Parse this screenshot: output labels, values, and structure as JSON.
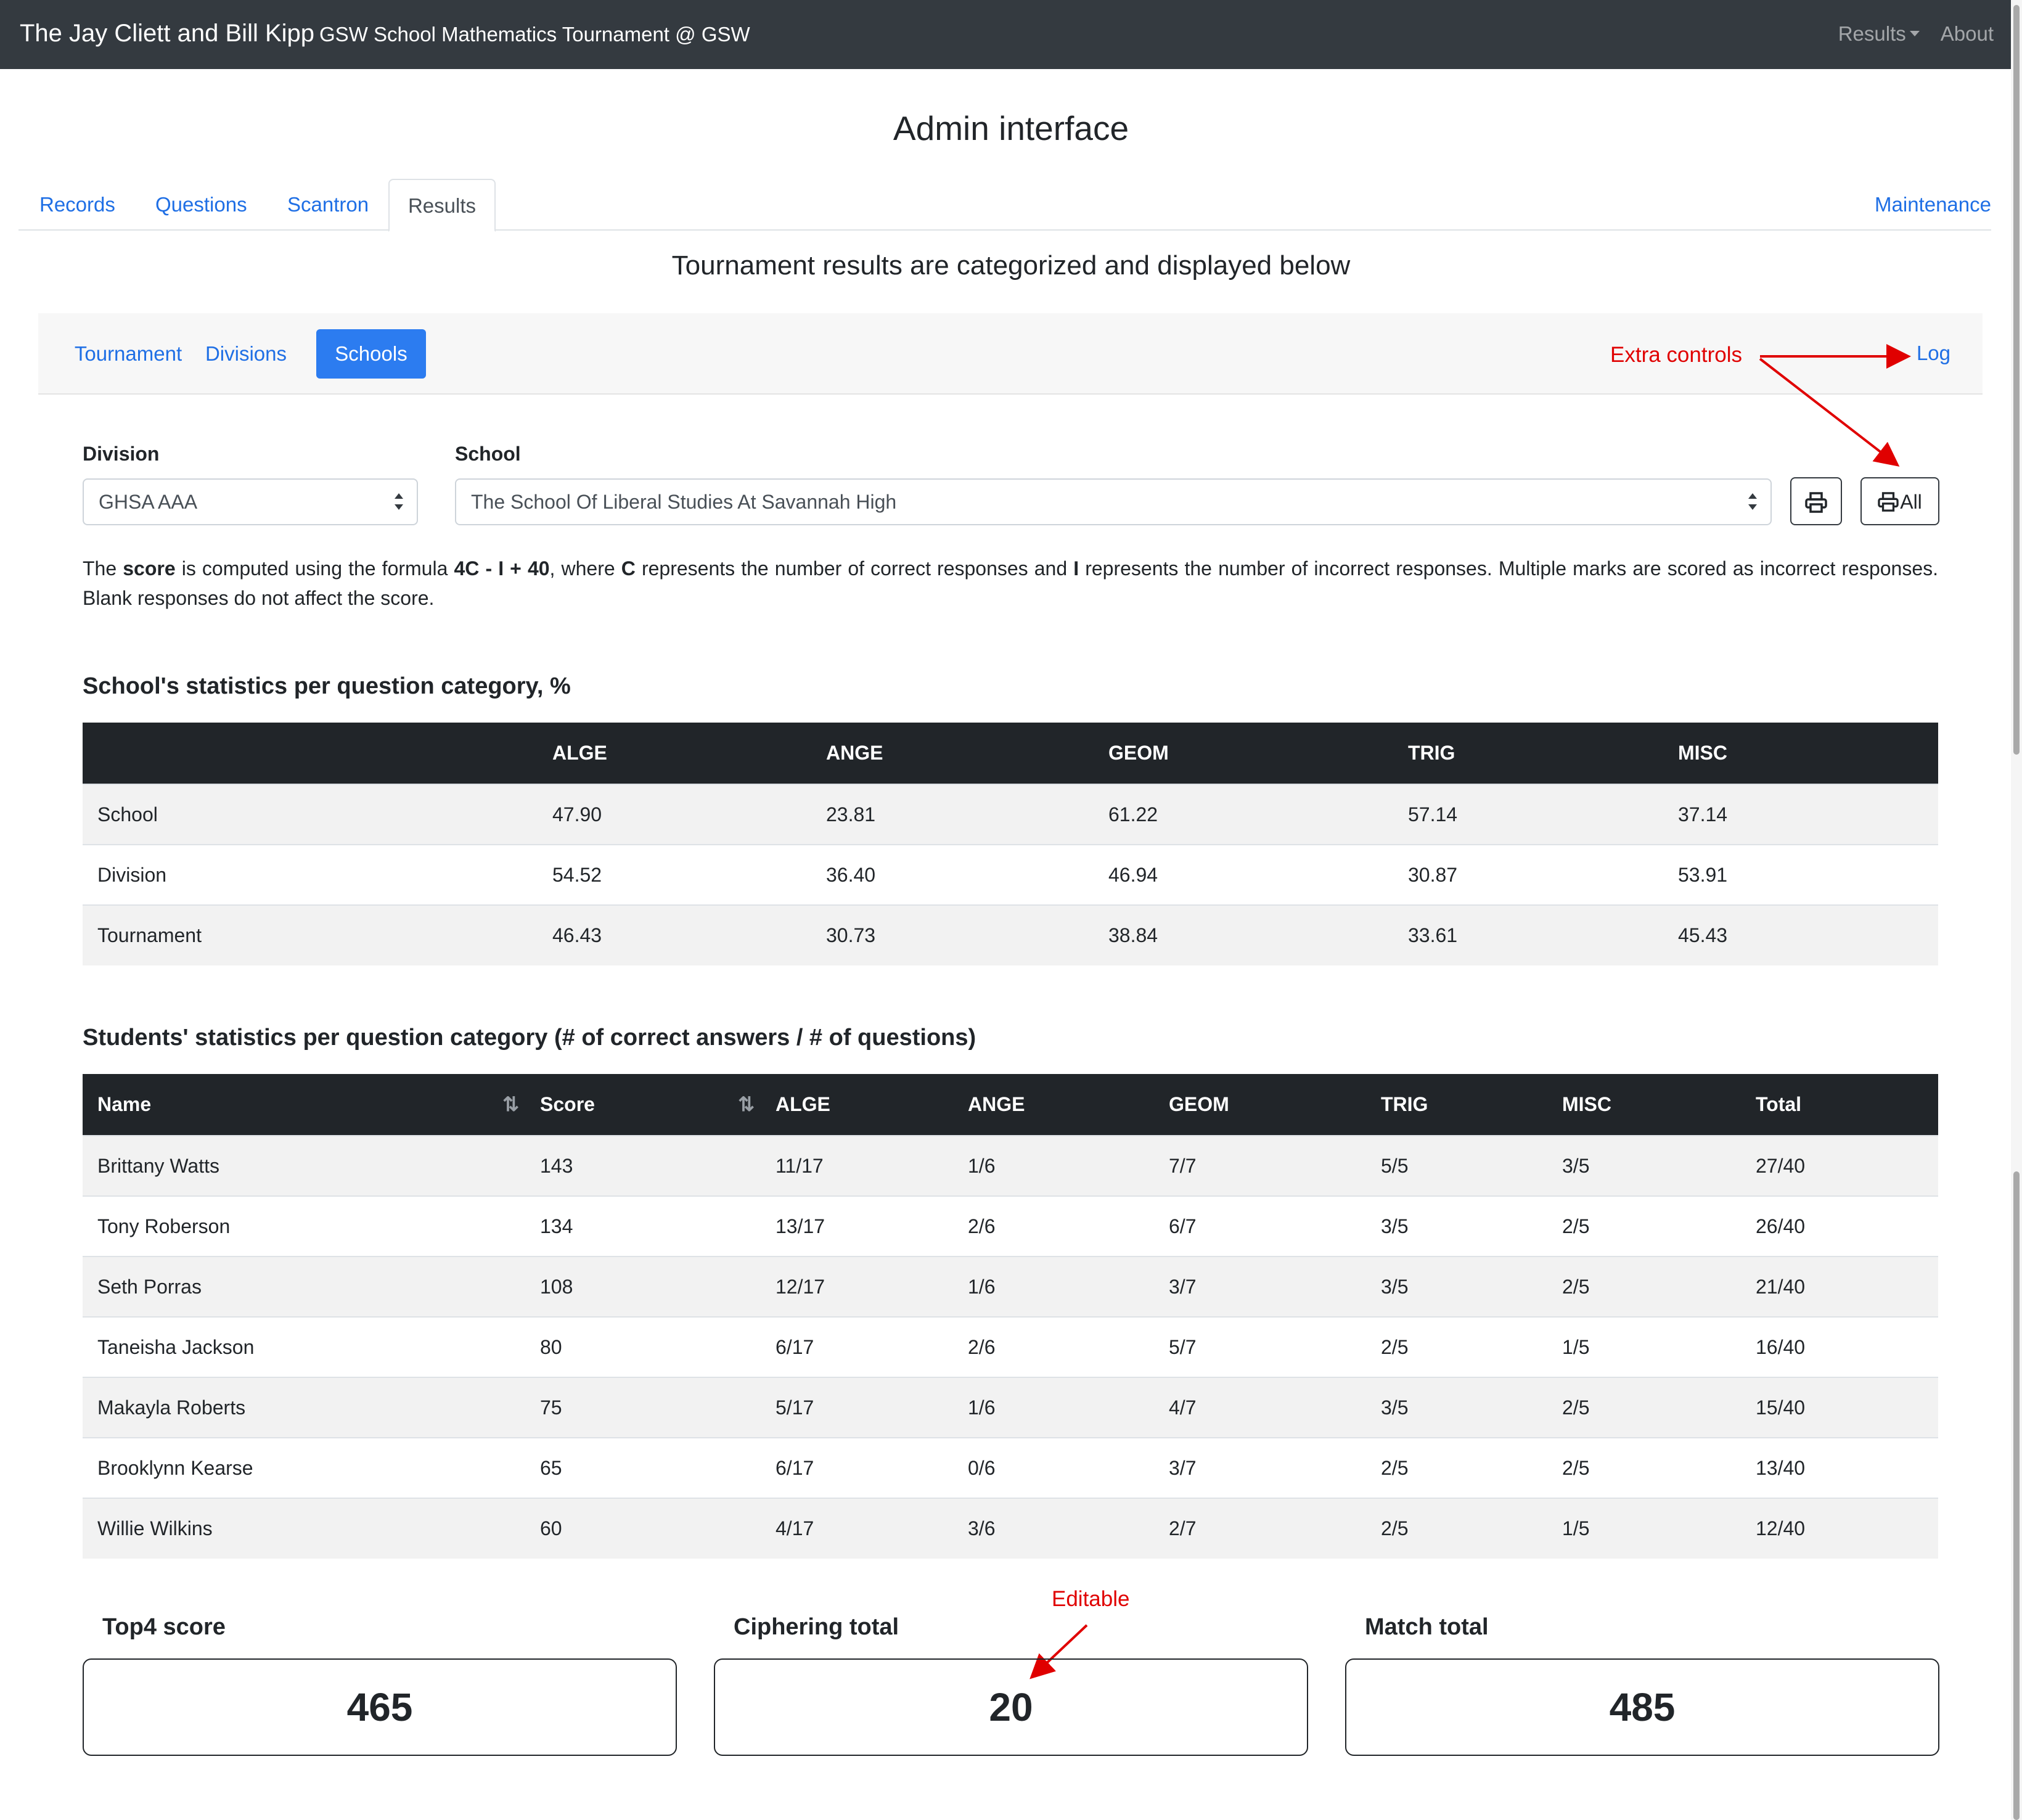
{
  "navbar": {
    "brand_main": "The Jay Cliett and Bill Kipp",
    "brand_sub": "GSW School Mathematics Tournament @ GSW",
    "results_menu": "Results",
    "about": "About"
  },
  "page_title": "Admin interface",
  "main_tabs": [
    "Records",
    "Questions",
    "Scantron",
    "Results"
  ],
  "maintenance": "Maintenance",
  "subtitle": "Tournament results are categorized and displayed below",
  "sub_tabs": [
    "Tournament",
    "Divisions",
    "Schools"
  ],
  "log_link": "Log",
  "annotations": {
    "extra_controls": "Extra controls",
    "editable": "Editable"
  },
  "form": {
    "division_label": "Division",
    "division_value": "GHSA AAA",
    "school_label": "School",
    "school_value": "The School Of Liberal Studies At Savannah High",
    "print_all_label": "All"
  },
  "description": {
    "t1": "The ",
    "b1": "score",
    "t2": " is computed using the formula ",
    "b2": "4C - I + 40",
    "t3": ", where ",
    "b3": "C",
    "t4": " represents the number of correct responses and ",
    "b4": "I",
    "t5": " represents the number of incorrect responses. Multiple marks are scored as incorrect responses. Blank responses do not affect the score."
  },
  "school_stats": {
    "title": "School's statistics per question category, %",
    "headers": [
      "",
      "ALGE",
      "ANGE",
      "GEOM",
      "TRIG",
      "MISC"
    ],
    "rows": [
      [
        "School",
        "47.90",
        "23.81",
        "61.22",
        "57.14",
        "37.14"
      ],
      [
        "Division",
        "54.52",
        "36.40",
        "46.94",
        "30.87",
        "53.91"
      ],
      [
        "Tournament",
        "46.43",
        "30.73",
        "38.84",
        "33.61",
        "45.43"
      ]
    ]
  },
  "student_stats": {
    "title": "Students' statistics per question category (# of correct answers / # of questions)",
    "headers": [
      "Name",
      "Score",
      "ALGE",
      "ANGE",
      "GEOM",
      "TRIG",
      "MISC",
      "Total"
    ],
    "rows": [
      [
        "Brittany Watts",
        "143",
        "11/17",
        "1/6",
        "7/7",
        "5/5",
        "3/5",
        "27/40"
      ],
      [
        "Tony Roberson",
        "134",
        "13/17",
        "2/6",
        "6/7",
        "3/5",
        "2/5",
        "26/40"
      ],
      [
        "Seth Porras",
        "108",
        "12/17",
        "1/6",
        "3/7",
        "3/5",
        "2/5",
        "21/40"
      ],
      [
        "Taneisha Jackson",
        "80",
        "6/17",
        "2/6",
        "5/7",
        "2/5",
        "1/5",
        "16/40"
      ],
      [
        "Makayla Roberts",
        "75",
        "5/17",
        "1/6",
        "4/7",
        "3/5",
        "2/5",
        "15/40"
      ],
      [
        "Brooklynn Kearse",
        "65",
        "6/17",
        "0/6",
        "3/7",
        "2/5",
        "2/5",
        "13/40"
      ],
      [
        "Willie Wilkins",
        "60",
        "4/17",
        "3/6",
        "2/7",
        "2/5",
        "1/5",
        "12/40"
      ]
    ]
  },
  "totals": {
    "top4_label": "Top4 score",
    "top4_value": "465",
    "ciphering_label": "Ciphering total",
    "ciphering_value": "20",
    "match_label": "Match total",
    "match_value": "485"
  },
  "colors": {
    "navbar": "#343a40",
    "link": "#1f6fe5",
    "active_pill": "#2c7cf0",
    "annotation": "#e00000",
    "table_header": "#212529"
  },
  "icons": [
    "printer-icon",
    "sort-icon",
    "caret-down-icon",
    "select-arrows-icon"
  ]
}
